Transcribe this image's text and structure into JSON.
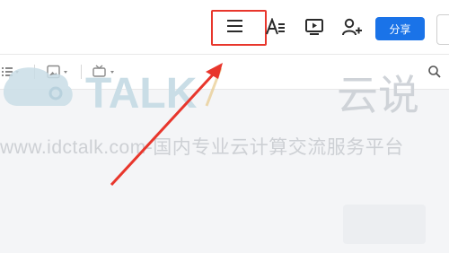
{
  "header": {
    "share_label": "分享"
  },
  "icons": {
    "menu": "menu-icon",
    "text_format": "text-format-icon",
    "present": "present-icon",
    "add_user": "add-user-icon",
    "list": "list-icon",
    "image": "image-icon",
    "embed": "embed-icon",
    "search": "search-icon"
  },
  "watermark": {
    "logo_text": "TALK",
    "logo_cn": "云说",
    "url_line": "www.idctalk.com-国内专业云计算交流服务平台"
  },
  "colors": {
    "accent": "#1a73e8",
    "highlight": "#e8362c",
    "watermark": "#c9ccd1"
  }
}
